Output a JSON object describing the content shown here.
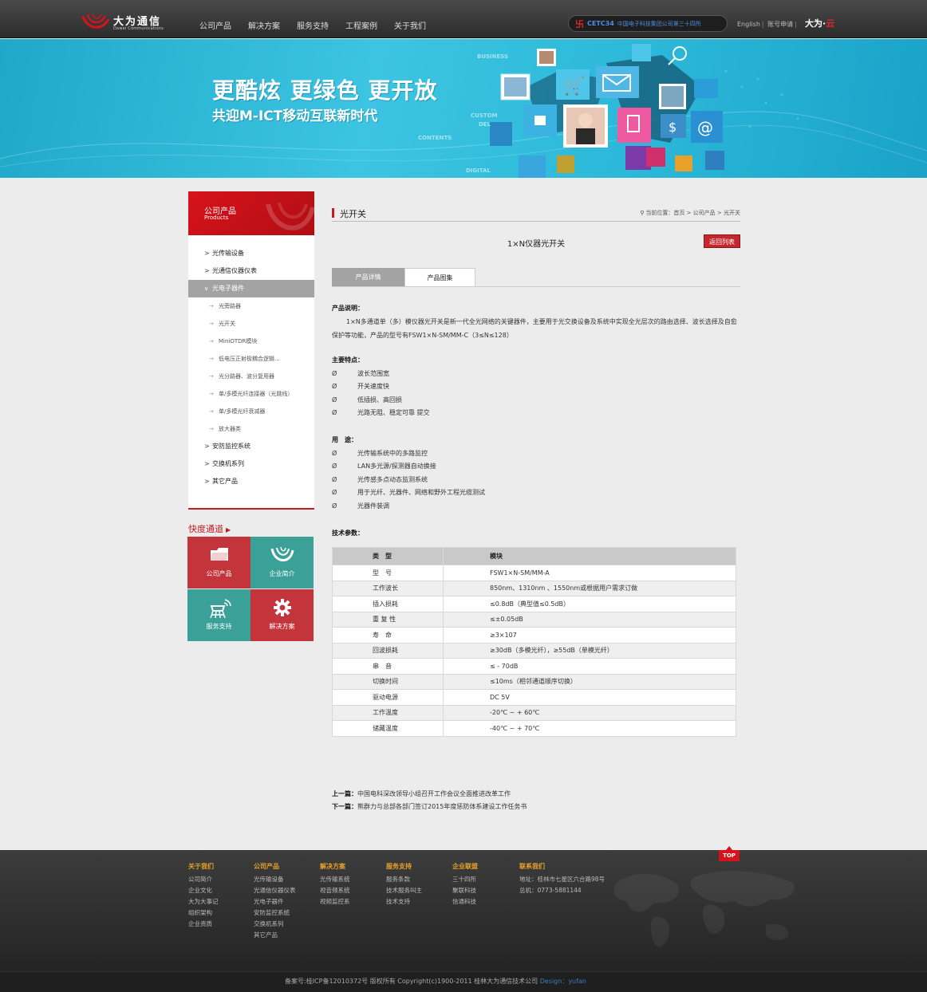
{
  "header": {
    "logo_cn": "大为通信",
    "logo_en": "Dawei Communications",
    "nav": [
      "公司产品",
      "解决方案",
      "服务支持",
      "工程案例",
      "关于我们"
    ],
    "cetc_mark": "卐",
    "cetc_name": "CETC34",
    "cetc_text": "中国电子科技集团公司第三十四所",
    "links": [
      "English",
      "账号申请"
    ],
    "dawei_brand": "大为·",
    "dawei_cloud": "云"
  },
  "banner": {
    "headline": "更酷炫 更绿色 更开放",
    "subline": "共迎M-ICT移动互联新时代",
    "bg_words": [
      "BUSINESS",
      "CUSTOM",
      "DEL",
      "CONTENTS",
      "DIGITAL"
    ]
  },
  "sidebar": {
    "title": "公司产品",
    "title_en": "Products",
    "arrow": ">",
    "sub_arrow": "→",
    "active_arrow": "∨",
    "items": [
      {
        "label": "光传输设备",
        "type": "top"
      },
      {
        "label": "光通信仪器仪表",
        "type": "top"
      },
      {
        "label": "光电子器件",
        "type": "active"
      },
      {
        "label": "光旁路器",
        "type": "sub"
      },
      {
        "label": "光开关",
        "type": "sub"
      },
      {
        "label": "MiniOTDR模块",
        "type": "sub"
      },
      {
        "label": "低电压正射极耦合逻辑...",
        "type": "sub"
      },
      {
        "label": "光分路器、波分复用器",
        "type": "sub"
      },
      {
        "label": "单/多模光纤连接器（光跳线）",
        "type": "sub"
      },
      {
        "label": "单/多模光纤衰减器",
        "type": "sub"
      },
      {
        "label": "放大器类",
        "type": "sub"
      },
      {
        "label": "安防监控系统",
        "type": "top"
      },
      {
        "label": "交换机系列",
        "type": "top"
      },
      {
        "label": "其它产品",
        "type": "top"
      }
    ],
    "quick_title": "快度通道",
    "quick_arrow": "▶",
    "quick": [
      {
        "label": "公司产品",
        "icon": "folder-icon"
      },
      {
        "label": "企业简介",
        "icon": "logo-swirl-icon"
      },
      {
        "label": "服务支持",
        "icon": "signal-tower-icon"
      },
      {
        "label": "解决方案",
        "icon": "gear-icon"
      }
    ]
  },
  "main": {
    "title": "光开关",
    "breadcrumb_pin": "⚲",
    "breadcrumb": "当前位置：首页 > 公司产品 > 光开关",
    "product_name": "1×N仪器光开关",
    "back_label": "返回列表",
    "tabs": [
      "产品详情",
      "产品图集"
    ],
    "desc_label": "产品说明：",
    "desc_text": "1×N多通道单（多）模仪器光开关是新一代全光网络的关键器件，主要用于光交换设备及系统中实现全光层次的路由选择、波长选择及自愈保护等功能，产品的型号有FSW1×N-SM/MM-C（3≤N≤128）",
    "bullet": "Ø",
    "features_label": "主要特点：",
    "features": [
      "波长范围宽",
      "开关速度快",
      "低插损、高回损",
      "光路无阻、稳定可靠 提交"
    ],
    "uses_label": "用　途：",
    "uses": [
      "光传输系统中的多路监控",
      "LAN多光源/探测器自动换接",
      "光传感多点动态监测系统",
      "用于光纤、光器件、网络和野外工程光缆测试",
      "光器件装调"
    ],
    "params_label": "技术参数：",
    "spec_header": [
      "类　型",
      "模块"
    ],
    "spec_rows": [
      [
        "型　号",
        "FSW1×N-SM/MM-A"
      ],
      [
        "工作波长",
        "850nm、1310nm 、1550nm或根据用户需求订做"
      ],
      [
        "插入损耗",
        "≤0.8dB（典型值≤0.5dB）"
      ],
      [
        "重 复 性",
        "≤±0.05dB"
      ],
      [
        "寿　命",
        "≥3×107"
      ],
      [
        "回波损耗",
        "≥30dB（多模光纤），≥55dB（单模光纤）"
      ],
      [
        "串　音",
        "≤ - 70dB"
      ],
      [
        "切换时间",
        "≤10ms（相邻通道顺序切换）"
      ],
      [
        "驱动电源",
        "DC 5V"
      ],
      [
        "工作温度",
        "-20℃ ~ + 60℃"
      ],
      [
        "储藏温度",
        "-40℃ ~ + 70℃"
      ]
    ],
    "prev_label": "上一篇：",
    "prev_text": "中国电科深改领导小组召开工作会议全面推进改革工作",
    "next_label": "下一篇：",
    "next_text": "熊群力与总部各部门签订2015年度惩防体系建设工作任务书"
  },
  "footer": {
    "top_label": "TOP",
    "cols": [
      {
        "title": "关于我们",
        "items": [
          "公司简介",
          "企业文化",
          "大为大事记",
          "组织架构",
          "企业资质"
        ]
      },
      {
        "title": "公司产品",
        "items": [
          "光传输设备",
          "光通信仪器仪表",
          "光电子器件",
          "安防监控系统",
          "交换机系列",
          "其它产品"
        ]
      },
      {
        "title": "解决方案",
        "items": [
          "光传输系统",
          "视音频系统",
          "视频监控系"
        ]
      },
      {
        "title": "服务支持",
        "items": [
          "服务条款",
          "技术服务叫主",
          "技术支持"
        ]
      },
      {
        "title": "企业联盟",
        "items": [
          "三十四所",
          "聚联科技",
          "信通科技"
        ]
      },
      {
        "title": "联系我们",
        "items": [
          "地址：桂林市七星区六合路98号",
          "总机：0773-5881144"
        ]
      }
    ],
    "copyright": "备案号:桂ICP备12010372号  版权所有 Copyright(c)1900-2011  桂林大为通信技术公司",
    "design": "Design：yufan"
  },
  "colors": {
    "brand_red": "#c41a20",
    "teal": "#3aa098",
    "banner": "#2bb7d8",
    "footer_heading": "#e8a32a"
  }
}
